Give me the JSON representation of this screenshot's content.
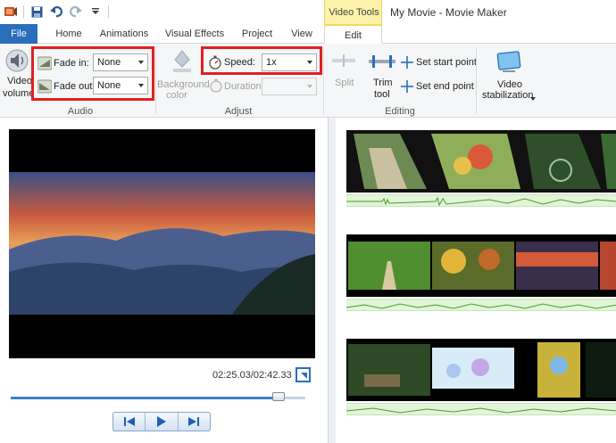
{
  "window": {
    "title": "My Movie - Movie Maker",
    "context_tab_group": "Video Tools"
  },
  "tabs": [
    {
      "label": "File"
    },
    {
      "label": "Home"
    },
    {
      "label": "Animations"
    },
    {
      "label": "Visual Effects"
    },
    {
      "label": "Project"
    },
    {
      "label": "View"
    },
    {
      "label": "Edit"
    }
  ],
  "ribbon": {
    "audio": {
      "group_label": "Audio",
      "video_volume_label_1": "Video",
      "video_volume_label_2": "volume",
      "fade_in_label": "Fade in:",
      "fade_in_value": "None",
      "fade_out_label": "Fade out:",
      "fade_out_value": "None"
    },
    "adjust": {
      "group_label": "Adjust",
      "background_color_label_1": "Background",
      "background_color_label_2": "color",
      "speed_label": "Speed:",
      "speed_value": "1x",
      "duration_label": "Duration:",
      "duration_value": ""
    },
    "editing": {
      "group_label": "Editing",
      "split_label": "Split",
      "trim_tool_label_1": "Trim",
      "trim_tool_label_2": "tool",
      "set_start_point_label": "Set start point",
      "set_end_point_label": "Set end point"
    },
    "stabilization": {
      "label_1": "Video",
      "label_2": "stabilization"
    }
  },
  "preview": {
    "timecode": "02:25.03/02:42.33",
    "progress_fraction": 0.91
  },
  "colors": {
    "accent": "#2a6ebb",
    "highlight_box": "#e02020",
    "context_tab": "#fcf2a9"
  },
  "icons": {
    "save": "save-icon",
    "undo": "undo-icon",
    "redo": "redo-icon",
    "fullscreen": "fullscreen-icon",
    "previous_frame": "previous-frame-icon",
    "play": "play-icon",
    "next_frame": "next-frame-icon"
  }
}
